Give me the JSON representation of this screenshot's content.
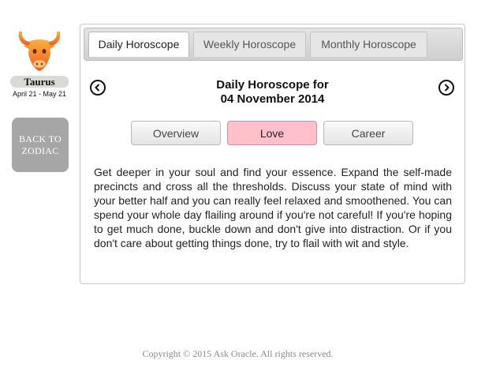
{
  "sign": {
    "name": "Taurus",
    "dates": "April 21 - May 21",
    "icon": "taurus-bull-icon",
    "icon_color": "#f7931e"
  },
  "back_button": {
    "label": "BACK TO ZODIAC"
  },
  "tabs": [
    {
      "label": "Daily Horoscope",
      "active": true
    },
    {
      "label": "Weekly Horoscope",
      "active": false
    },
    {
      "label": "Monthly Horoscope",
      "active": false
    }
  ],
  "header": {
    "title_line1": "Daily Horoscope for",
    "title_line2": "04 November 2014"
  },
  "sub_tabs": [
    {
      "label": "Overview",
      "active": false
    },
    {
      "label": "Love",
      "active": true,
      "color": "#ffc0cb"
    },
    {
      "label": "Career",
      "active": false
    }
  ],
  "content": {
    "text": "Get deeper in your soul and find your essence. Expand the self-made precincts and cross all the thresholds. Discuss your state of mind with your better half and you can really feel relaxed and smoothened. You can spend your whole day flailing around if you're not careful! If you're hoping to get much done, buckle down and don't give into distraction. Or if you don't care about getting things done, try to flail with wit and style."
  },
  "footer": {
    "text": "Copyright © 2015 Ask Oracle. All rights reserved."
  }
}
